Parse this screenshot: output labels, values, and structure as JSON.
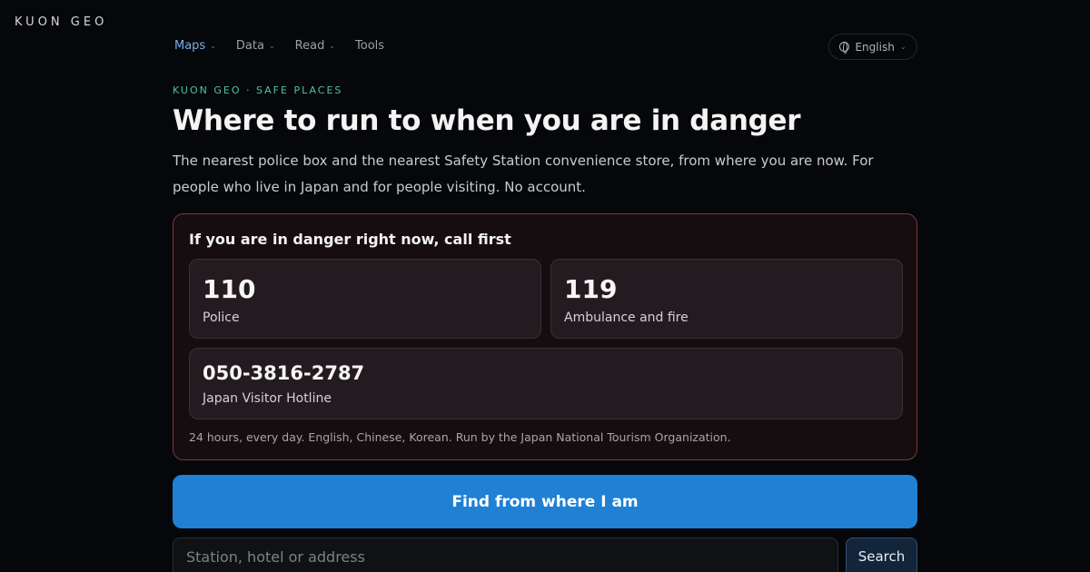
{
  "brand": "KUON GEO",
  "nav": {
    "items": [
      {
        "label": "Maps",
        "has_dropdown": true,
        "active": true
      },
      {
        "label": "Data",
        "has_dropdown": true,
        "active": false
      },
      {
        "label": "Read",
        "has_dropdown": true,
        "active": false
      },
      {
        "label": "Tools",
        "has_dropdown": false,
        "active": false
      }
    ]
  },
  "language": {
    "label": "English",
    "icon": "globe-icon"
  },
  "hero": {
    "eyebrow": "KUON GEO · SAFE PLACES",
    "title": "Where to run to when you are in danger",
    "description": "The nearest police box and the nearest Safety Station convenience store, from where you are now. For people who live in Japan and for people visiting. No account."
  },
  "emergency": {
    "heading": "If you are in danger right now, call first",
    "numbers": [
      {
        "number": "110",
        "label": "Police"
      },
      {
        "number": "119",
        "label": "Ambulance and fire"
      },
      {
        "number": "050-3816-2787",
        "label": "Japan Visitor Hotline"
      }
    ],
    "note": "24 hours, every day. English, Chinese, Korean. Run by the Japan National Tourism Organization."
  },
  "actions": {
    "find_label": "Find from where I am",
    "search_placeholder": "Station, hotel or address",
    "search_value": "",
    "search_button": "Search"
  },
  "colors": {
    "background": "#06070a",
    "accent_green": "#4fc39c",
    "accent_blue": "#1f80d4",
    "danger_border": "#7a3a34",
    "nav_active": "#79aee8"
  }
}
